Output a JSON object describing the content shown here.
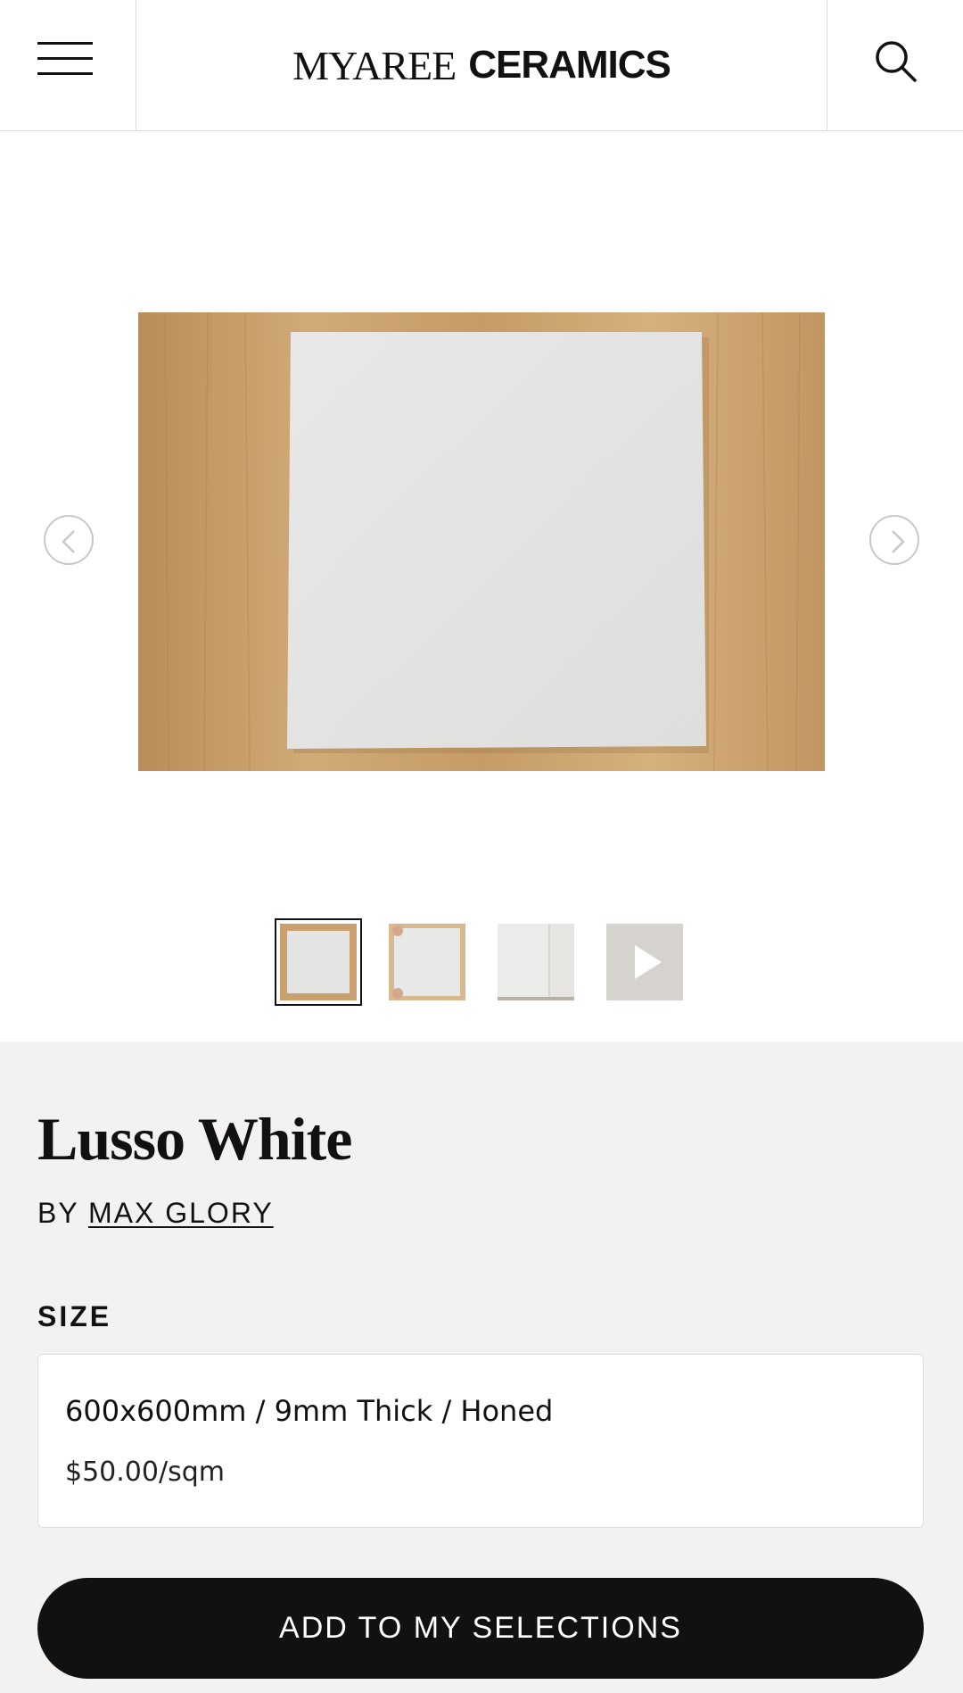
{
  "header": {
    "brand_part1": "MYAREE",
    "brand_part2": "CERAMICS",
    "menu_icon": "hamburger-menu-icon",
    "search_icon": "search-icon"
  },
  "gallery": {
    "main_image": "white tile on wooden floor",
    "prev_icon": "chevron-left-icon",
    "next_icon": "chevron-right-icon",
    "thumbnails": [
      {
        "kind": "image",
        "active": true
      },
      {
        "kind": "image",
        "active": false
      },
      {
        "kind": "image",
        "active": false
      },
      {
        "kind": "video",
        "active": false,
        "icon": "play-icon"
      }
    ]
  },
  "product": {
    "title": "Lusso White",
    "by_label": "BY",
    "brand": "MAX GLORY",
    "size_label": "SIZE",
    "size_option": {
      "name": "600x600mm / 9mm Thick / Honed",
      "price": "$50.00/sqm"
    },
    "cta_label": "ADD TO MY SELECTIONS"
  },
  "colors": {
    "panel_bg": "#f3f2f1",
    "cta_bg": "#111111",
    "wood": "#c9a06e",
    "tile": "#e5e5e3"
  }
}
